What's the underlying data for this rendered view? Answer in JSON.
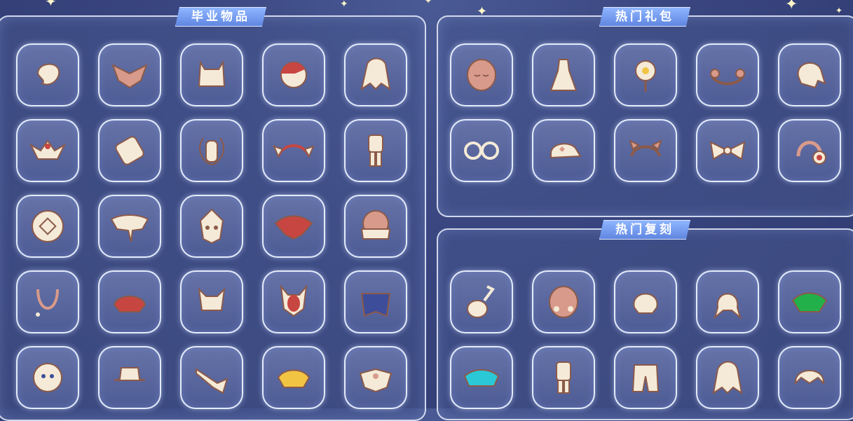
{
  "sections": [
    {
      "title": "毕业物品",
      "items": [
        {
          "icon": "hair-curl-icon"
        },
        {
          "icon": "cape-wings-icon"
        },
        {
          "icon": "horned-hood-icon"
        },
        {
          "icon": "crescent-mask-icon"
        },
        {
          "icon": "long-hair-icon"
        },
        {
          "icon": "jester-collar-icon"
        },
        {
          "icon": "scroll-instrument-icon"
        },
        {
          "icon": "moon-mask-icon"
        },
        {
          "icon": "wing-headband-icon"
        },
        {
          "icon": "outfit-icon"
        },
        {
          "icon": "shield-ornament-icon"
        },
        {
          "icon": "white-cape-icon"
        },
        {
          "icon": "owl-mask-icon"
        },
        {
          "icon": "red-cape-icon"
        },
        {
          "icon": "scarf-mask-icon"
        },
        {
          "icon": "necklace-icon"
        },
        {
          "icon": "red-cape-short-icon"
        },
        {
          "icon": "horn-hair-icon"
        },
        {
          "icon": "horned-red-mask-icon"
        },
        {
          "icon": "blue-cape-icon"
        },
        {
          "icon": "round-mask-icon"
        },
        {
          "icon": "hat-icon"
        },
        {
          "icon": "horn-instrument-icon"
        },
        {
          "icon": "yellow-cape-icon"
        },
        {
          "icon": "white-collar-cape-icon"
        }
      ]
    },
    {
      "title": "热门礼包",
      "items": [
        {
          "icon": "sleepy-mask-icon"
        },
        {
          "icon": "dress-outfit-icon"
        },
        {
          "icon": "flower-icon"
        },
        {
          "icon": "flower-headband-icon"
        },
        {
          "icon": "ponytail-hair-icon"
        },
        {
          "icon": "round-glasses-icon"
        },
        {
          "icon": "cap-icon"
        },
        {
          "icon": "ear-headband-icon"
        },
        {
          "icon": "bow-icon"
        },
        {
          "icon": "headphones-icon"
        }
      ]
    },
    {
      "title": "热门复刻",
      "items": [
        {
          "icon": "ukulele-icon"
        },
        {
          "icon": "blush-mask-icon"
        },
        {
          "icon": "twin-buns-hair-icon"
        },
        {
          "icon": "twin-tails-hair-icon"
        },
        {
          "icon": "green-cape-icon"
        },
        {
          "icon": "cyan-cape-icon"
        },
        {
          "icon": "white-outfit-icon"
        },
        {
          "icon": "pants-icon"
        },
        {
          "icon": "curly-hair-icon"
        },
        {
          "icon": "short-hair-icon"
        }
      ]
    }
  ],
  "colors": {
    "accent": "#6f94ec",
    "slot_border": "#ebf2ff",
    "item_cream": "#f4ead7",
    "item_brown": "#8b5a4a",
    "item_red": "#c84642",
    "item_blue": "#3d4d9a",
    "item_green": "#22b04a",
    "item_cyan": "#2bc8d8",
    "item_pink": "#d89a8a",
    "item_yellow": "#f2c444"
  }
}
